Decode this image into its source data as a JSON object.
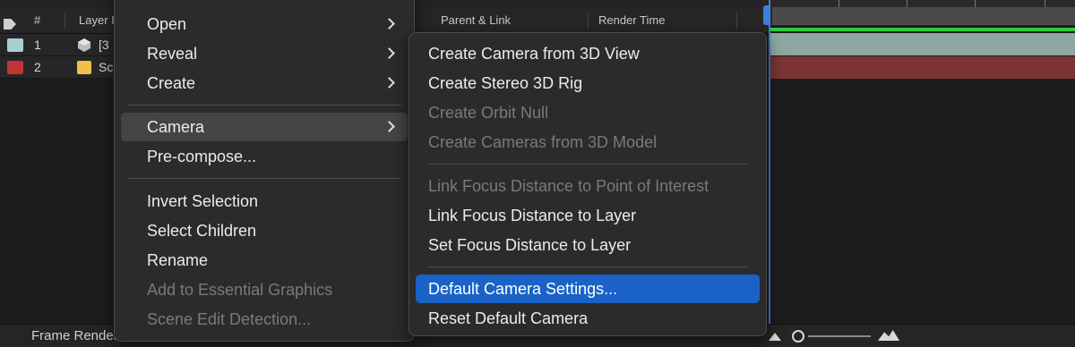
{
  "timeline": {
    "header": {
      "number_label": "#",
      "layer_label": "Layer I",
      "parent_label": "Parent & Link",
      "render_label": "Render Time"
    },
    "layers": [
      {
        "number": "1",
        "name": "[3",
        "label_color": "#a9cfcd"
      },
      {
        "number": "2",
        "name": "Sc",
        "label_color": "#c53434"
      }
    ],
    "bottom": {
      "frame_render_label": "Frame Render Time"
    }
  },
  "context_menu": {
    "items": [
      {
        "label": "Open",
        "submenu": true,
        "disabled": false
      },
      {
        "label": "Reveal",
        "submenu": true,
        "disabled": false
      },
      {
        "label": "Create",
        "submenu": true,
        "disabled": false
      },
      {
        "label": "Camera",
        "submenu": true,
        "disabled": false,
        "highlighted": true
      },
      {
        "label": "Pre-compose...",
        "submenu": false,
        "disabled": false
      },
      {
        "label": "Invert Selection",
        "submenu": false,
        "disabled": false
      },
      {
        "label": "Select Children",
        "submenu": false,
        "disabled": false
      },
      {
        "label": "Rename",
        "submenu": false,
        "disabled": false
      },
      {
        "label": "Add to Essential Graphics",
        "submenu": false,
        "disabled": true
      },
      {
        "label": "Scene Edit Detection...",
        "submenu": false,
        "disabled": true
      }
    ]
  },
  "camera_submenu": {
    "items": [
      {
        "label": "Create Camera from 3D View",
        "disabled": false
      },
      {
        "label": "Create Stereo 3D Rig",
        "disabled": false
      },
      {
        "label": "Create Orbit Null",
        "disabled": true
      },
      {
        "label": "Create Cameras from 3D Model",
        "disabled": true
      },
      {
        "label": "Link Focus Distance to Point of Interest",
        "disabled": true
      },
      {
        "label": "Link Focus Distance to Layer",
        "disabled": false
      },
      {
        "label": "Set Focus Distance to Layer",
        "disabled": false
      },
      {
        "label": "Default Camera Settings...",
        "disabled": false,
        "selected": true
      },
      {
        "label": "Reset Default Camera",
        "disabled": false
      }
    ]
  },
  "colors": {
    "selection": "#1a62c6",
    "playhead": "#3d7fe0",
    "work_area_green": "#2ecc40",
    "layer1_bar": "#8fa7a2",
    "layer2_bar": "#7a3434"
  }
}
